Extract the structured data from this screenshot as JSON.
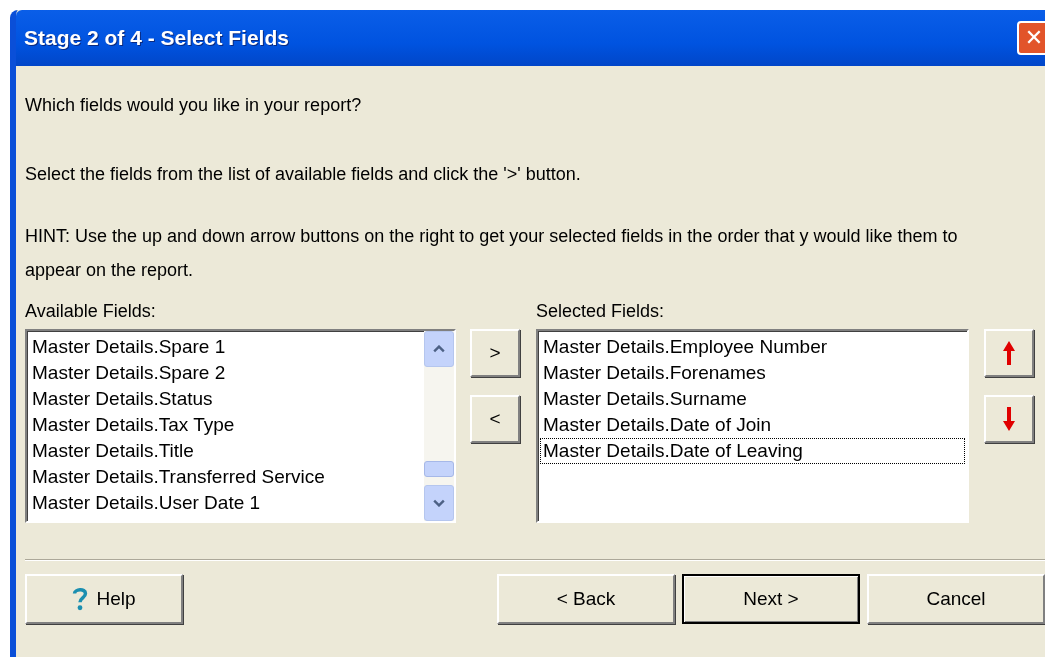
{
  "window": {
    "title": "Stage 2 of 4 - Select Fields",
    "close": "✕"
  },
  "intro": [
    "Which fields would you like in your report?",
    "Select the fields from the list of available fields and click the '>' button.",
    "HINT: Use the up and down arrow buttons on the right to get your selected fields in the order that y would like them to appear on the report."
  ],
  "available": {
    "label": "Available Fields:",
    "items": [
      "Master Details.Spare 1",
      "Master Details.Spare 2",
      "Master Details.Status",
      "Master Details.Tax Type",
      "Master Details.Title",
      "Master Details.Transferred Service",
      "Master Details.User Date 1"
    ]
  },
  "move_buttons": [
    ">",
    "<"
  ],
  "selected": {
    "label": "Selected Fields:",
    "items": [
      {
        "text": "Master Details.Employee Number",
        "focused": false
      },
      {
        "text": "Master Details.Forenames",
        "focused": false
      },
      {
        "text": "Master Details.Surname",
        "focused": false
      },
      {
        "text": "Master Details.Date of Join",
        "focused": false
      },
      {
        "text": "Master Details.Date of Leaving",
        "focused": true
      }
    ]
  },
  "footer": [
    {
      "kind": "help",
      "label": "Help",
      "default": false
    },
    {
      "kind": "nav",
      "label": "< Back",
      "default": false
    },
    {
      "kind": "nav",
      "label": "Next >",
      "default": true
    },
    {
      "kind": "nav",
      "label": "Cancel",
      "default": false
    }
  ]
}
